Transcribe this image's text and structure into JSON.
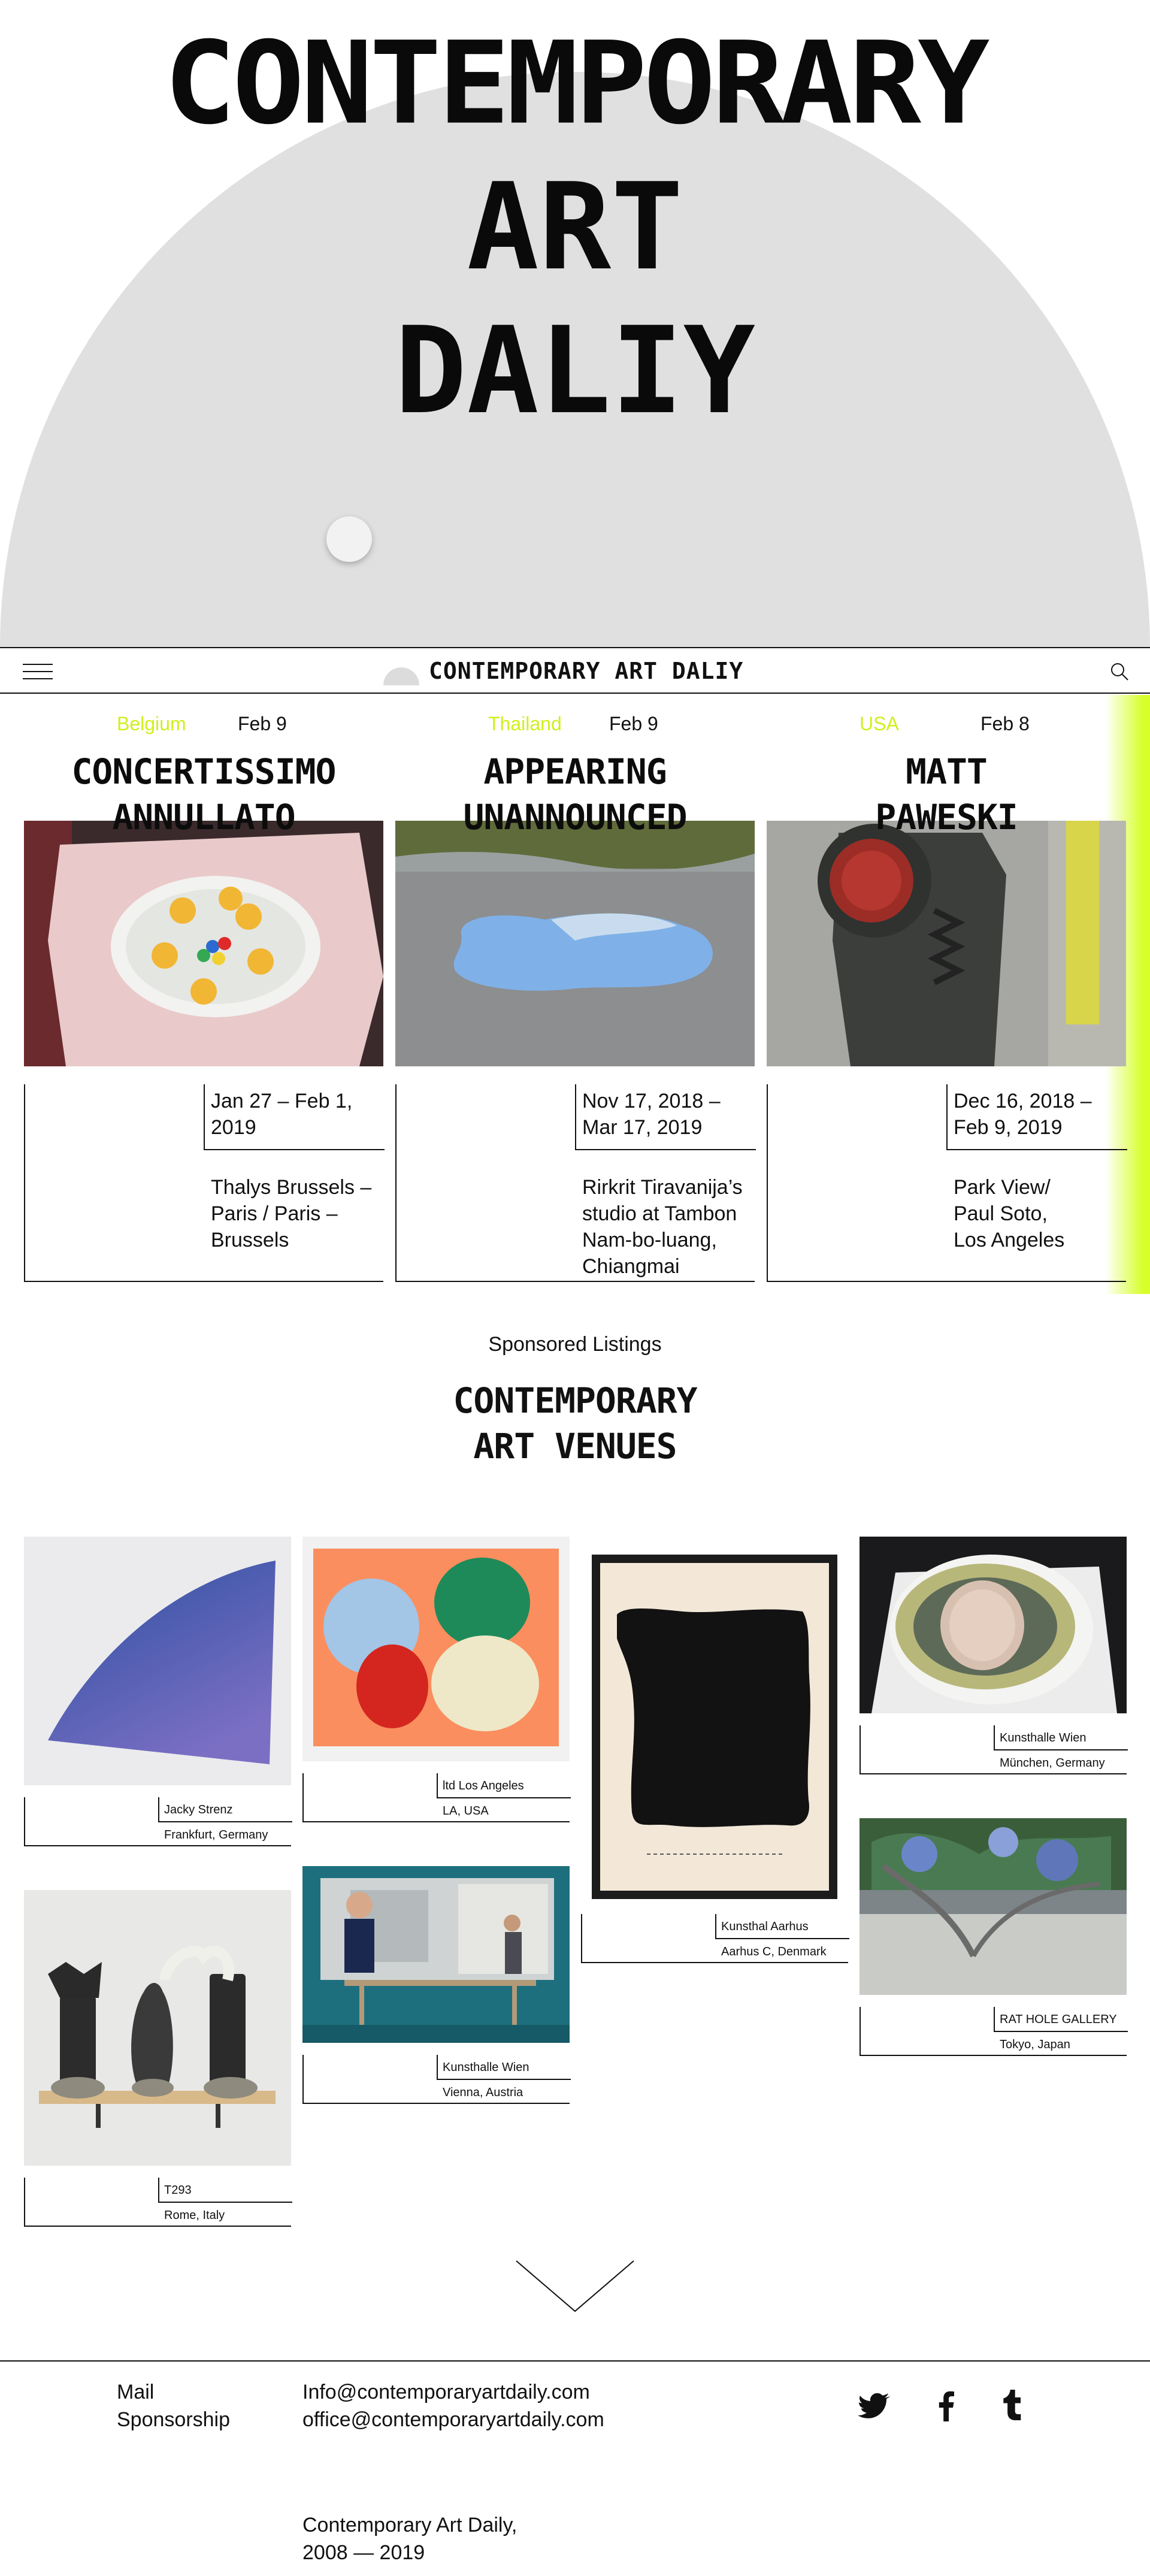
{
  "hero": {
    "title_line1": "CONTEMPORARY",
    "title_line2": "ART",
    "title_line3": "DALIY"
  },
  "nav": {
    "logo": "CONTEMPORARY ART DALIY",
    "menu_icon": "hamburger-menu-icon",
    "search_icon": "search-icon"
  },
  "stories": [
    {
      "country": "Belgium",
      "date": "Feb 9",
      "title_line1": "CONCERTISSIMO",
      "title_line2": "ANNULLATO",
      "range_line1": "Jan 27 – Feb 1,",
      "range_line2": "2019",
      "venue_lines": [
        "Thalys Brussels –",
        "Paris / Paris –",
        "Brussels"
      ]
    },
    {
      "country": "Thailand",
      "date": "Feb 9",
      "title_line1": "APPEARING",
      "title_line2": "UNANNOUNCED",
      "range_line1": "Nov 17, 2018 –",
      "range_line2": "Mar 17, 2019",
      "venue_lines": [
        "Rirkrit Tiravanija’s",
        "studio at Tambon",
        "Nam-bo-luang,",
        "Chiangmai"
      ]
    },
    {
      "country": "USA",
      "date": "Feb 8",
      "title_line1": "MATT",
      "title_line2": "PAWESKI",
      "range_line1": "Dec 16, 2018 –",
      "range_line2": "Feb 9, 2019",
      "venue_lines": [
        "Park View/",
        "Paul Soto,",
        "Los Angeles"
      ]
    }
  ],
  "sponsored": {
    "label": "Sponsored Listings",
    "title_line1": "CONTEMPORARY",
    "title_line2": "ART VENUES"
  },
  "venues": [
    {
      "gallery": "Jacky Strenz",
      "city": "Frankfurt, Germany"
    },
    {
      "gallery": "ltd Los Angeles",
      "city": "LA, USA"
    },
    {
      "gallery": "Kunsthal Aarhus",
      "city": "Aarhus C, Denmark"
    },
    {
      "gallery": "Kunsthalle Wien",
      "city": "München, Germany"
    },
    {
      "gallery": "T293",
      "city": "Rome, Italy"
    },
    {
      "gallery": "Kunsthalle Wien",
      "city": "Vienna, Austria"
    },
    {
      "gallery": "RAT HOLE GALLERY",
      "city": "Tokyo, Japan"
    }
  ],
  "footer": {
    "mail_label": "Mail",
    "sponsorship_label": "Sponsorship",
    "mail_email": "Info@contemporaryartdaily.com",
    "sponsorship_email": "office@contemporaryartdaily.com",
    "copyright_line1": "Contemporary Art Daily,",
    "copyright_line2": "2008 — 2019",
    "social_icons": [
      "twitter-icon",
      "facebook-icon",
      "tumblr-icon"
    ]
  },
  "colors": {
    "accent_lime": "#d7ff2a",
    "hero_gray": "#e0e0e0",
    "text": "#111111"
  }
}
